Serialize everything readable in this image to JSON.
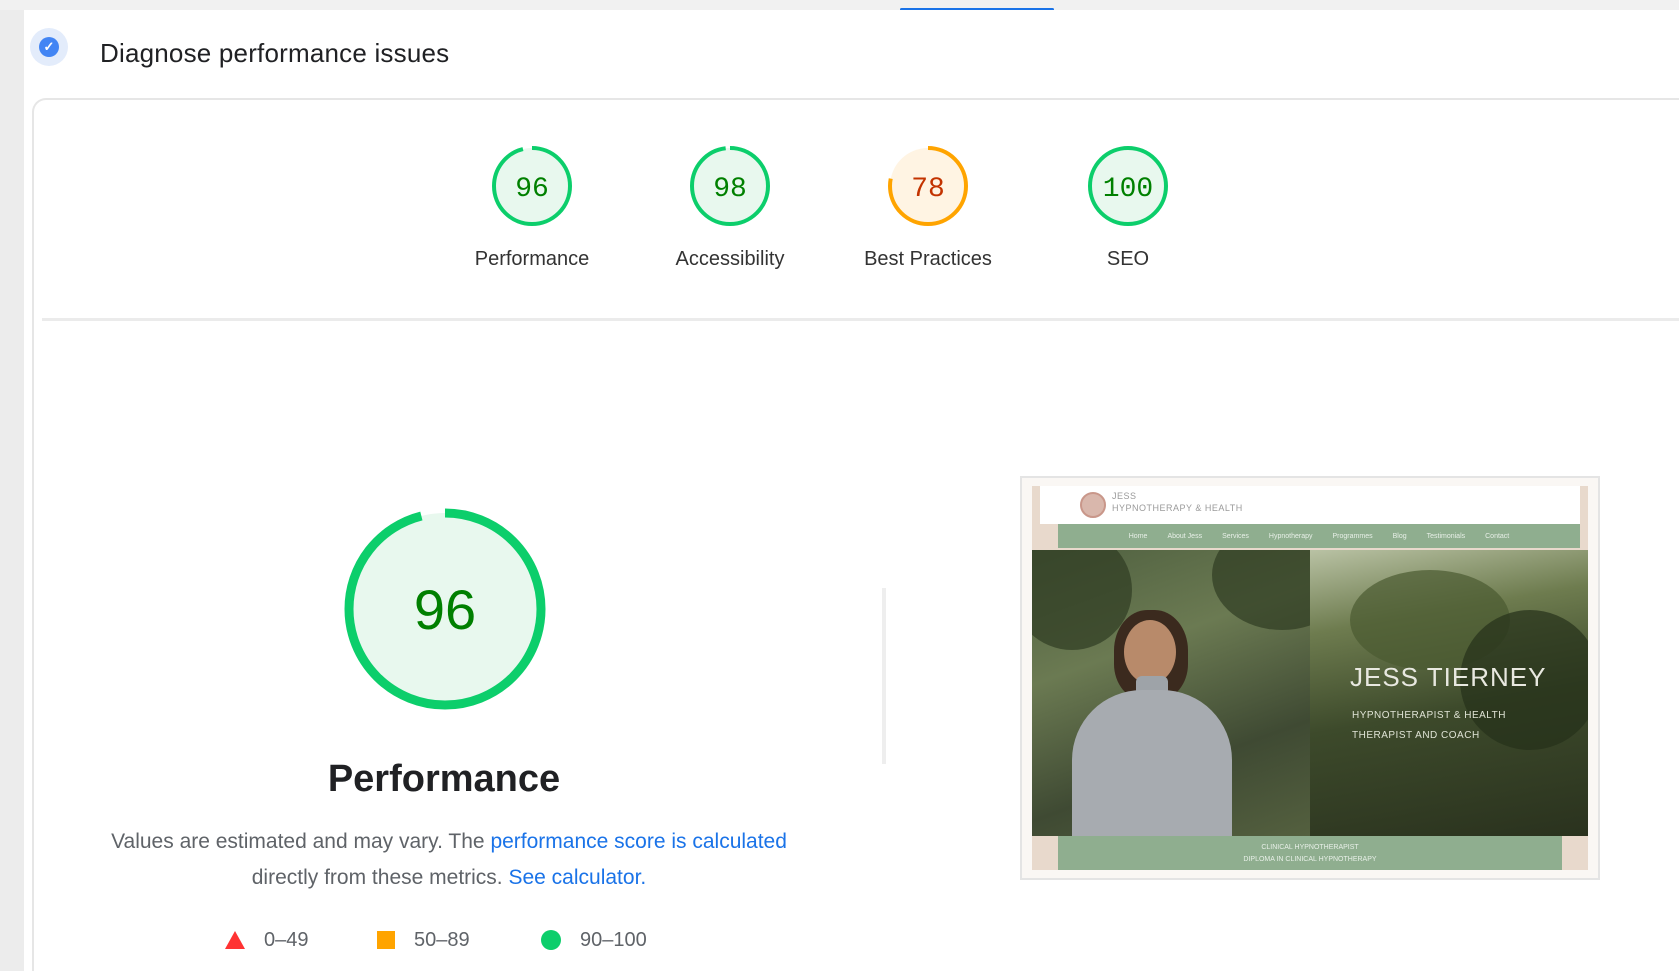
{
  "header": {
    "title": "Diagnose performance issues"
  },
  "colors": {
    "pass": "#0cce6b",
    "pass_text": "#008000",
    "average": "#ffa400",
    "average_text": "#c33300",
    "fail": "#ff4e42",
    "link": "#1a73e8"
  },
  "categories": [
    {
      "label": "Performance",
      "score": "96",
      "score_value": 96,
      "rating": "pass"
    },
    {
      "label": "Accessibility",
      "score": "98",
      "score_value": 98,
      "rating": "pass"
    },
    {
      "label": "Best Practices",
      "score": "78",
      "score_value": 78,
      "rating": "average"
    },
    {
      "label": "SEO",
      "score": "100",
      "score_value": 100,
      "rating": "pass"
    }
  ],
  "performance": {
    "score": "96",
    "score_value": 96,
    "title": "Performance",
    "desc_prefix": "Values are estimated and may vary. The ",
    "desc_link1": "performance score is calculated",
    "desc_middle": " directly from these metrics. ",
    "desc_link2": "See calculator."
  },
  "legend": [
    {
      "icon": "triangle-icon",
      "range": "0–49"
    },
    {
      "icon": "square-icon",
      "range": "50–89"
    },
    {
      "icon": "circle-icon",
      "range": "90–100"
    }
  ],
  "screenshot": {
    "brand_line1": "JESS",
    "brand_line2": "HYPNOTHERAPY & HEALTH",
    "nav_items": [
      "Home",
      "About Jess",
      "Services",
      "Hypnotherapy",
      "Programmes",
      "Blog",
      "Testimonials",
      "Contact"
    ],
    "hero_title": "JESS TIERNEY",
    "hero_sub1": "HYPNOTHERAPIST & HEALTH",
    "hero_sub2": "THERAPIST AND COACH",
    "footer_line1": "CLINICAL HYPNOTHERAPIST",
    "footer_line2": "DIPLOMA IN CLINICAL HYPNOTHERAPY"
  }
}
